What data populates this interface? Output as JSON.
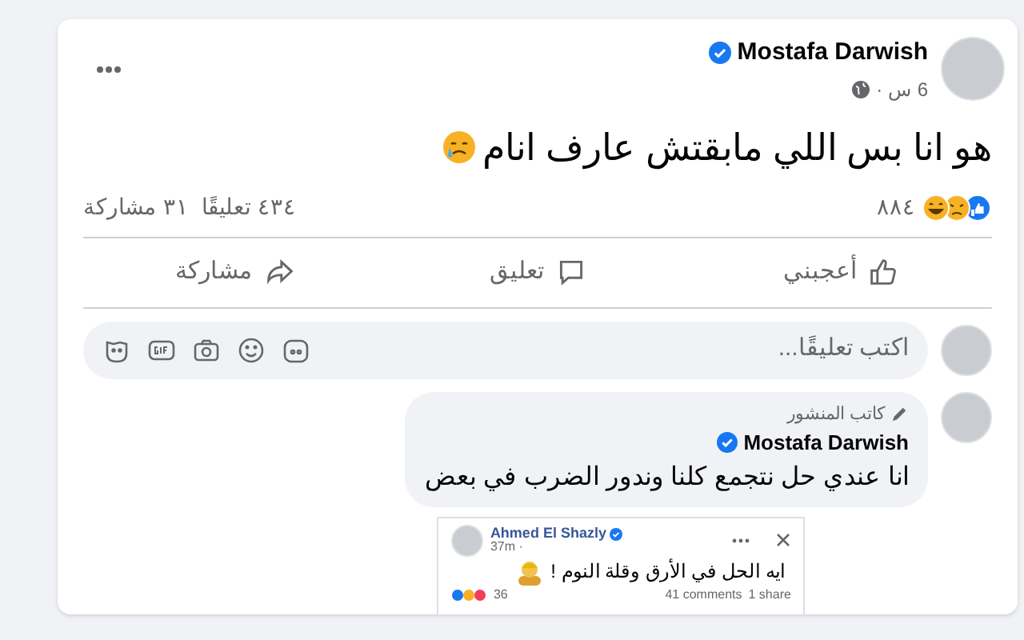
{
  "post": {
    "author": "Mostafa Darwish",
    "verified": true,
    "time": "6 س ·",
    "text": "هو انا بس اللي مابقتش عارف انام",
    "reactions_count": "٨٨٤",
    "comments_count": "٤٣٤ تعليقًا",
    "shares_count": "٣١ مشاركة"
  },
  "actions": [
    {
      "kind": "like",
      "label": "أعجبني"
    },
    {
      "kind": "comment",
      "label": "تعليق"
    },
    {
      "kind": "share",
      "label": "مشاركة"
    }
  ],
  "comment_box": {
    "placeholder": "اكتب تعليقًا..."
  },
  "comment": {
    "badge": "كاتب المنشور",
    "author": "Mostafa Darwish",
    "verified": true,
    "text": "انا عندي حل نتجمع كلنا وندور الضرب في بعض",
    "shared_post": {
      "author": "Ahmed El Shazly",
      "verified": true,
      "time": "37m ·",
      "text": "ايه الحل في الأرق وقلة النوم !",
      "reactions_count": "36",
      "comments_count": "41 comments",
      "shares_count": "1 share"
    }
  }
}
